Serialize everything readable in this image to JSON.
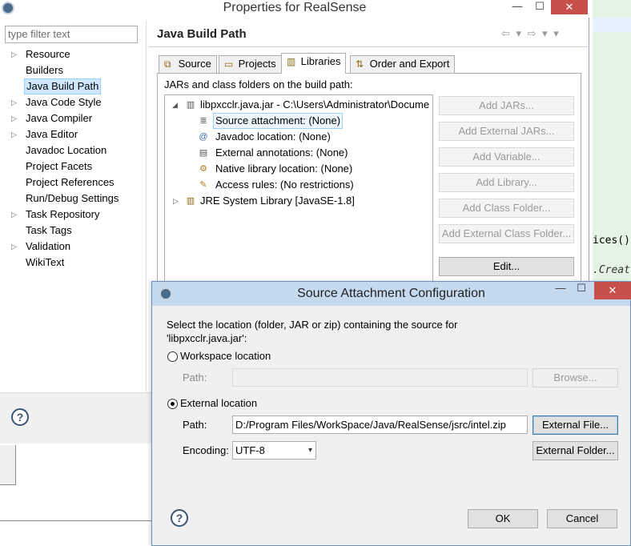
{
  "background_editor": {
    "code_line_1": "ices()",
    "code_line_2": ".Creat"
  },
  "window": {
    "title": "Properties for RealSense",
    "close_glyph": "✕",
    "maximize_glyph": "☐",
    "minimize_glyph": "—"
  },
  "filter": {
    "placeholder": "type filter text"
  },
  "tree": {
    "items": [
      {
        "label": "Resource",
        "arrow": "▷"
      },
      {
        "label": "Builders",
        "arrow": ""
      },
      {
        "label": "Java Build Path",
        "arrow": ""
      },
      {
        "label": "Java Code Style",
        "arrow": "▷"
      },
      {
        "label": "Java Compiler",
        "arrow": "▷"
      },
      {
        "label": "Java Editor",
        "arrow": "▷"
      },
      {
        "label": "Javadoc Location",
        "arrow": ""
      },
      {
        "label": "Project Facets",
        "arrow": ""
      },
      {
        "label": "Project References",
        "arrow": ""
      },
      {
        "label": "Run/Debug Settings",
        "arrow": ""
      },
      {
        "label": "Task Repository",
        "arrow": "▷"
      },
      {
        "label": "Task Tags",
        "arrow": ""
      },
      {
        "label": "Validation",
        "arrow": "▷"
      },
      {
        "label": "WikiText",
        "arrow": ""
      }
    ],
    "selected_index": 2
  },
  "page": {
    "title": "Java Build Path",
    "nav_icons": "⇦ ▾ ⇨ ▾ ▾"
  },
  "tabs": [
    {
      "label": "Source",
      "icon": "source-icon",
      "glyph": "⧉"
    },
    {
      "label": "Projects",
      "icon": "projects-icon",
      "glyph": "▭"
    },
    {
      "label": "Libraries",
      "icon": "libraries-icon",
      "glyph": "▥"
    },
    {
      "label": "Order and Export",
      "icon": "order-icon",
      "glyph": "⇅"
    }
  ],
  "active_tab": "Libraries",
  "libraries": {
    "heading": "JARs and class folders on the build path:",
    "jar": {
      "label": "libpxcclr.java.jar - C:\\Users\\Administrator\\Docume",
      "expand": "◢",
      "children": [
        {
          "label": "Source attachment: (None)",
          "icon": "source-attachment-icon",
          "glyph": "≣"
        },
        {
          "label": "Javadoc location: (None)",
          "icon": "javadoc-icon",
          "glyph": "@"
        },
        {
          "label": "External annotations: (None)",
          "icon": "annotations-icon",
          "glyph": "▤"
        },
        {
          "label": "Native library location: (None)",
          "icon": "native-library-icon",
          "glyph": "⚙"
        },
        {
          "label": "Access rules: (No restrictions)",
          "icon": "access-rules-icon",
          "glyph": "✎"
        }
      ]
    },
    "jre": {
      "label": "JRE System Library [JavaSE-1.8]",
      "expand": "▷",
      "glyph": "▥"
    },
    "buttons": [
      {
        "label": "Add JARs...",
        "enabled": false
      },
      {
        "label": "Add External JARs...",
        "enabled": false
      },
      {
        "label": "Add Variable...",
        "enabled": false
      },
      {
        "label": "Add Library...",
        "enabled": false
      },
      {
        "label": "Add Class Folder...",
        "enabled": false
      },
      {
        "label": "Add External Class Folder...",
        "enabled": false
      },
      {
        "label": "Edit...",
        "enabled": true
      }
    ]
  },
  "help_glyph": "?",
  "dialog": {
    "title": "Source Attachment Configuration",
    "close_glyph": "✕",
    "maximize_glyph": "☐",
    "minimize_glyph": "—",
    "description_line1": "Select the location (folder, JAR or zip) containing the source for",
    "description_line2": "'libpxcclr.java.jar':",
    "workspace": {
      "label": "Workspace location",
      "path_label": "Path:",
      "path_value": "",
      "browse_label": "Browse...",
      "selected": false
    },
    "external": {
      "label": "External location",
      "path_label": "Path:",
      "path_value": "D:/Program Files/WorkSpace/Java/RealSense/jsrc/intel.zip",
      "external_file_label": "External File...",
      "encoding_label": "Encoding:",
      "encoding_value": "UTF-8",
      "external_folder_label": "External Folder...",
      "selected": true
    },
    "ok_label": "OK",
    "cancel_label": "Cancel"
  }
}
